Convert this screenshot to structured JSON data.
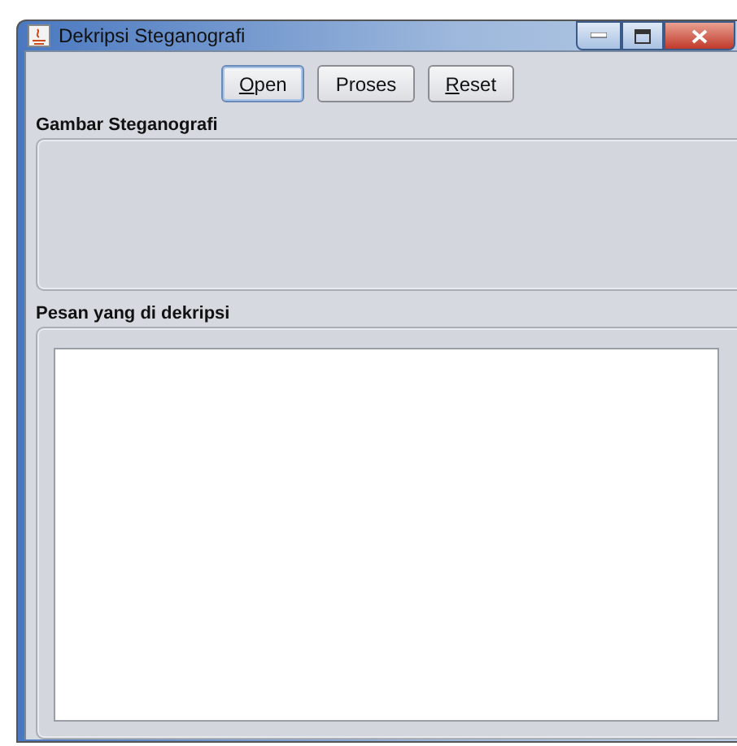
{
  "window": {
    "title": "Dekripsi Steganografi"
  },
  "buttons": [
    {
      "underlined": "O",
      "rest": "pen",
      "focused": true
    },
    {
      "rest": "Proses",
      "focused": false
    },
    {
      "underlined": "R",
      "rest": "eset",
      "focused": false
    }
  ],
  "image_section": {
    "title": "Gambar Steganografi"
  },
  "message_section": {
    "title": "Pesan yang di dekripsi"
  }
}
